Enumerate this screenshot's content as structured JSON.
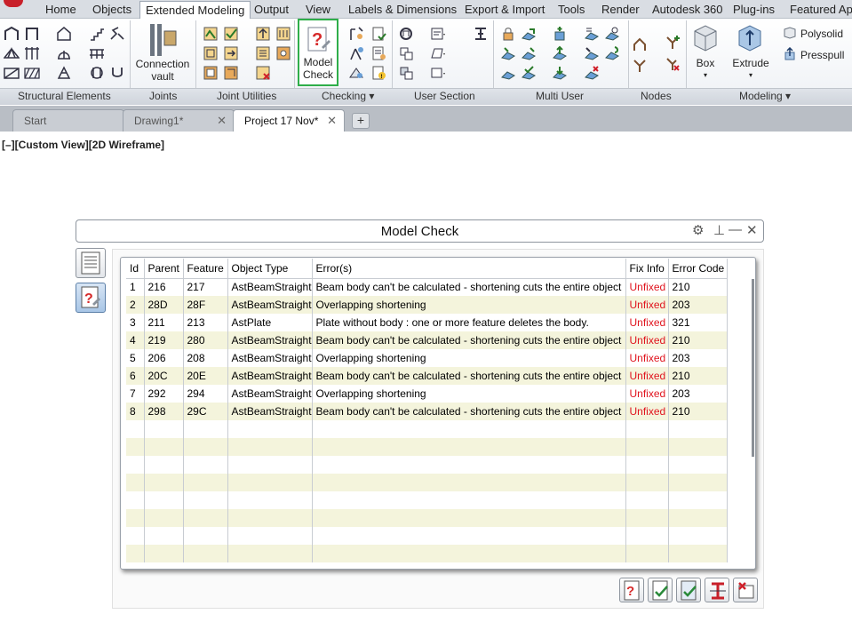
{
  "colors": {
    "accent_green": "#2fae4a",
    "unfixed_red": "#e0141e",
    "row_alt": "#f4f4dc"
  },
  "menu": {
    "tabs": [
      {
        "label": "Home"
      },
      {
        "label": "Objects"
      },
      {
        "label": "Extended Modeling",
        "active": true
      },
      {
        "label": "Output"
      },
      {
        "label": "View"
      },
      {
        "label": "Labels & Dimensions"
      },
      {
        "label": "Export & Import"
      },
      {
        "label": "Tools"
      },
      {
        "label": "Render"
      },
      {
        "label": "Autodesk 360"
      },
      {
        "label": "Plug-ins"
      },
      {
        "label": "Featured Apps"
      }
    ]
  },
  "ribbon": {
    "connection_vault": {
      "line1": "Connection",
      "line2": "vault"
    },
    "model_check": {
      "line1": "Model",
      "line2": "Check"
    },
    "box": {
      "label": "Box"
    },
    "extrude": {
      "label": "Extrude"
    },
    "polysolid": {
      "label": "Polysolid"
    },
    "presspull": {
      "label": "Presspull"
    },
    "panels": [
      {
        "label": "Structural Elements"
      },
      {
        "label": "Joints"
      },
      {
        "label": "Joint Utilities"
      },
      {
        "label": "Checking ▾"
      },
      {
        "label": "User Section"
      },
      {
        "label": "Multi User"
      },
      {
        "label": "Nodes"
      },
      {
        "label": "Modeling ▾"
      }
    ]
  },
  "doc_tabs": [
    {
      "label": "Start"
    },
    {
      "label": "Drawing1*"
    },
    {
      "label": "Project 17 Nov*"
    }
  ],
  "viewport_label": "[–][Custom View][2D Wireframe]",
  "palette": {
    "title": "Model Check",
    "columns": [
      "Id",
      "Parent",
      "Feature",
      "Object Type",
      "Error(s)",
      "Fix Info",
      "Error Code"
    ],
    "rows": [
      {
        "id": "1",
        "parent": "216",
        "feature": "217",
        "type": "AstBeamStraight",
        "error": "Beam body can't be calculated - shortening cuts the entire object",
        "fix": "Unfixed",
        "code": "210"
      },
      {
        "id": "2",
        "parent": "28D",
        "feature": "28F",
        "type": "AstBeamStraight",
        "error": "Overlapping shortening",
        "fix": "Unfixed",
        "code": "203"
      },
      {
        "id": "3",
        "parent": "211",
        "feature": "213",
        "type": "AstPlate",
        "error": "Plate without body : one or more feature deletes the body.",
        "fix": "Unfixed",
        "code": "321"
      },
      {
        "id": "4",
        "parent": "219",
        "feature": "280",
        "type": "AstBeamStraight",
        "error": "Beam body can't be calculated - shortening cuts the entire object",
        "fix": "Unfixed",
        "code": "210"
      },
      {
        "id": "5",
        "parent": "206",
        "feature": "208",
        "type": "AstBeamStraight",
        "error": "Overlapping shortening",
        "fix": "Unfixed",
        "code": "203"
      },
      {
        "id": "6",
        "parent": "20C",
        "feature": "20E",
        "type": "AstBeamStraight",
        "error": "Beam body can't be calculated - shortening cuts the entire object",
        "fix": "Unfixed",
        "code": "210"
      },
      {
        "id": "7",
        "parent": "292",
        "feature": "294",
        "type": "AstBeamStraight",
        "error": "Overlapping shortening",
        "fix": "Unfixed",
        "code": "203"
      },
      {
        "id": "8",
        "parent": "298",
        "feature": "29C",
        "type": "AstBeamStraight",
        "error": "Beam body can't be calculated - shortening cuts the entire object",
        "fix": "Unfixed",
        "code": "210"
      }
    ]
  }
}
